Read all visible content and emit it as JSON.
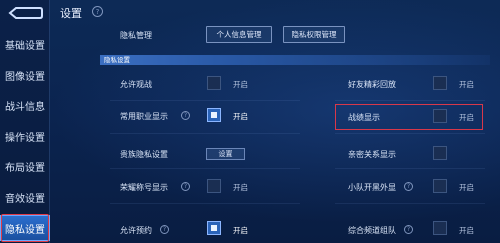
{
  "sidebar": {
    "back_icon": "back-arrow-icon",
    "items": [
      {
        "label": "基础设置"
      },
      {
        "label": "图像设置"
      },
      {
        "label": "战斗信息"
      },
      {
        "label": "操作设置"
      },
      {
        "label": "布局设置"
      },
      {
        "label": "音效设置"
      },
      {
        "label": "隐私设置",
        "active": true
      }
    ]
  },
  "header": {
    "title": "设置",
    "help_icon": "question-circle-icon"
  },
  "privacy_management": {
    "label": "隐私管理",
    "buttons": [
      "个人信息管理",
      "隐私权限管理"
    ]
  },
  "section": {
    "label": "隐私设置"
  },
  "settings": {
    "left": [
      {
        "label": "允许观战",
        "checked": false,
        "on_label": "开启"
      },
      {
        "label": "常用职业显示",
        "has_help": true,
        "checked": true,
        "on_label": "开启"
      },
      {
        "label": "贵族隐私设置",
        "button_label": "设置"
      },
      {
        "label": "荣耀称号显示",
        "has_help": true,
        "checked": false,
        "on_label": "开启"
      },
      {
        "label": "允许预约",
        "has_help": true,
        "checked": true,
        "on_label": "开启"
      }
    ],
    "right": [
      {
        "label": "好友精彩回放",
        "checked": false,
        "on_label": "开启"
      },
      {
        "label": "战绩显示",
        "checked": false,
        "on_label": "开启",
        "highlighted": true
      },
      {
        "label": "亲密关系显示",
        "checked": false,
        "on_label": ""
      },
      {
        "label": "小队开黑外显",
        "has_help": true,
        "checked": false,
        "on_label": "开启"
      },
      {
        "label": "综合频道组队",
        "has_help": true,
        "checked": false,
        "on_label": "开启"
      }
    ]
  },
  "colors": {
    "accent": "#2a63b8",
    "highlight": "#d8384a",
    "background": "#0b2450"
  }
}
